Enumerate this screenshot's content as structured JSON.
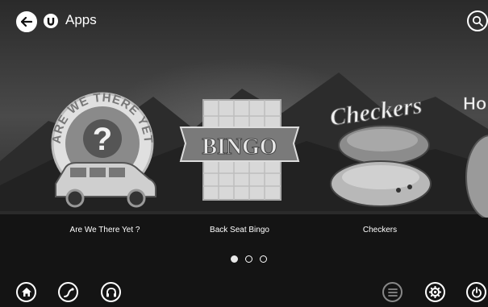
{
  "header": {
    "title": "Apps",
    "back_icon": "back-arrow-icon",
    "brand_icon": "u-logo-icon",
    "search_icon": "search-icon"
  },
  "apps": [
    {
      "label": "Are We There Yet ?",
      "badge_text": "ARE WE THERE YET",
      "glyph": "?"
    },
    {
      "label": "Back Seat Bingo",
      "banner_text": "BINGO"
    },
    {
      "label": "Checkers",
      "title_text": "Checkers"
    },
    {
      "label": "",
      "title_text": "Ho"
    }
  ],
  "pager": {
    "total": 3,
    "active": 1
  },
  "bottom_bar": {
    "left": [
      "home-icon",
      "navigation-icon",
      "headphones-icon"
    ],
    "right": [
      "menu-icon",
      "settings-icon",
      "power-icon"
    ]
  },
  "colors": {
    "accent": "#ffffff",
    "background": "#1a1a1a"
  }
}
